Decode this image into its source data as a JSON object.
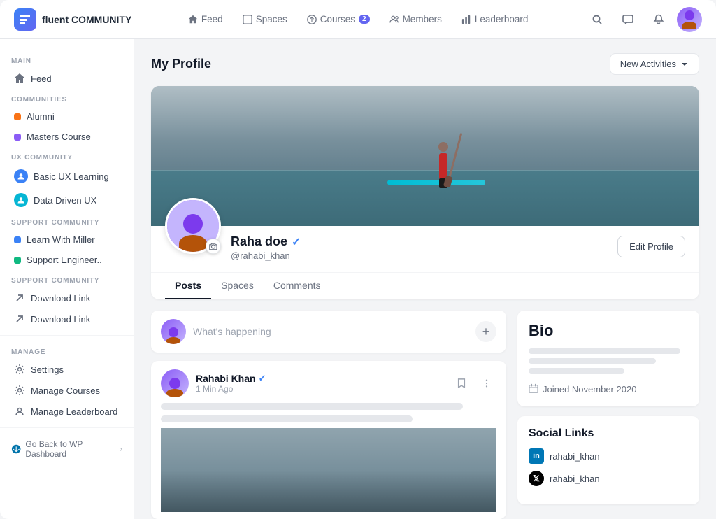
{
  "brand": {
    "icon_label": "fluent-icon",
    "name_prefix": "fluent",
    "name_suffix": "COMMUNITY"
  },
  "top_nav": {
    "links": [
      {
        "id": "feed",
        "label": "Feed",
        "badge": null
      },
      {
        "id": "spaces",
        "label": "Spaces",
        "badge": null
      },
      {
        "id": "courses",
        "label": "Courses",
        "badge": "2"
      },
      {
        "id": "members",
        "label": "Members",
        "badge": null
      },
      {
        "id": "leaderboard",
        "label": "Leaderboard",
        "badge": null
      }
    ],
    "new_activities_label": "New Activities"
  },
  "sidebar": {
    "sections": [
      {
        "label": "MAIN",
        "items": [
          {
            "id": "feed",
            "label": "Feed",
            "icon": "home"
          }
        ]
      },
      {
        "label": "COMMUNITIES",
        "items": [
          {
            "id": "alumni",
            "label": "Alumni",
            "dot": "orange"
          },
          {
            "id": "masters",
            "label": "Masters Course",
            "dot": "purple"
          }
        ]
      },
      {
        "label": "UX COMMUNITY",
        "items": [
          {
            "id": "basic-ux",
            "label": "Basic UX Learning",
            "dot": "blue"
          },
          {
            "id": "data-ux",
            "label": "Data Driven UX",
            "dot": "cyan"
          }
        ]
      },
      {
        "label": "SUPPORT COMMUNITY",
        "items": [
          {
            "id": "learn-miller",
            "label": "Learn With Miller",
            "dot": "blue"
          },
          {
            "id": "support-eng",
            "label": "Support Engineer..",
            "dot": "green"
          }
        ]
      },
      {
        "label": "SUPPORT COMMUNITY",
        "items": [
          {
            "id": "download1",
            "label": "Download Link",
            "icon": "arrow-upright"
          },
          {
            "id": "download2",
            "label": "Download Link",
            "icon": "arrow-upright"
          }
        ]
      }
    ],
    "manage": {
      "label": "MANAGE",
      "items": [
        {
          "id": "settings",
          "label": "Settings",
          "icon": "gear"
        },
        {
          "id": "manage-courses",
          "label": "Manage Courses",
          "icon": "gear"
        },
        {
          "id": "manage-leaderboard",
          "label": "Manage Leaderboard",
          "icon": "person"
        }
      ]
    },
    "wp_link": "Go Back to WP Dashboard"
  },
  "page": {
    "title": "My Profile",
    "new_activities_label": "New Activities"
  },
  "profile": {
    "name": "Raha doe",
    "handle": "@rahabi_khan",
    "verified": true,
    "edit_button": "Edit Profile",
    "tabs": [
      "Posts",
      "Spaces",
      "Comments"
    ],
    "active_tab": "Posts"
  },
  "post_box": {
    "placeholder": "What's happening"
  },
  "post": {
    "username": "Rahabi Khan",
    "verified": true,
    "time": "1 Min Ago",
    "text_lines": [
      {
        "width": "90%"
      },
      {
        "width": "75%"
      }
    ]
  },
  "bio": {
    "title": "Bio",
    "lines": [
      "long",
      "medium",
      "short"
    ],
    "joined": "Joined November 2020"
  },
  "social": {
    "title": "Social Links",
    "links": [
      {
        "platform": "linkedin",
        "handle": "rahabi_khan"
      },
      {
        "platform": "twitter",
        "handle": "rahabi_khan"
      }
    ]
  }
}
